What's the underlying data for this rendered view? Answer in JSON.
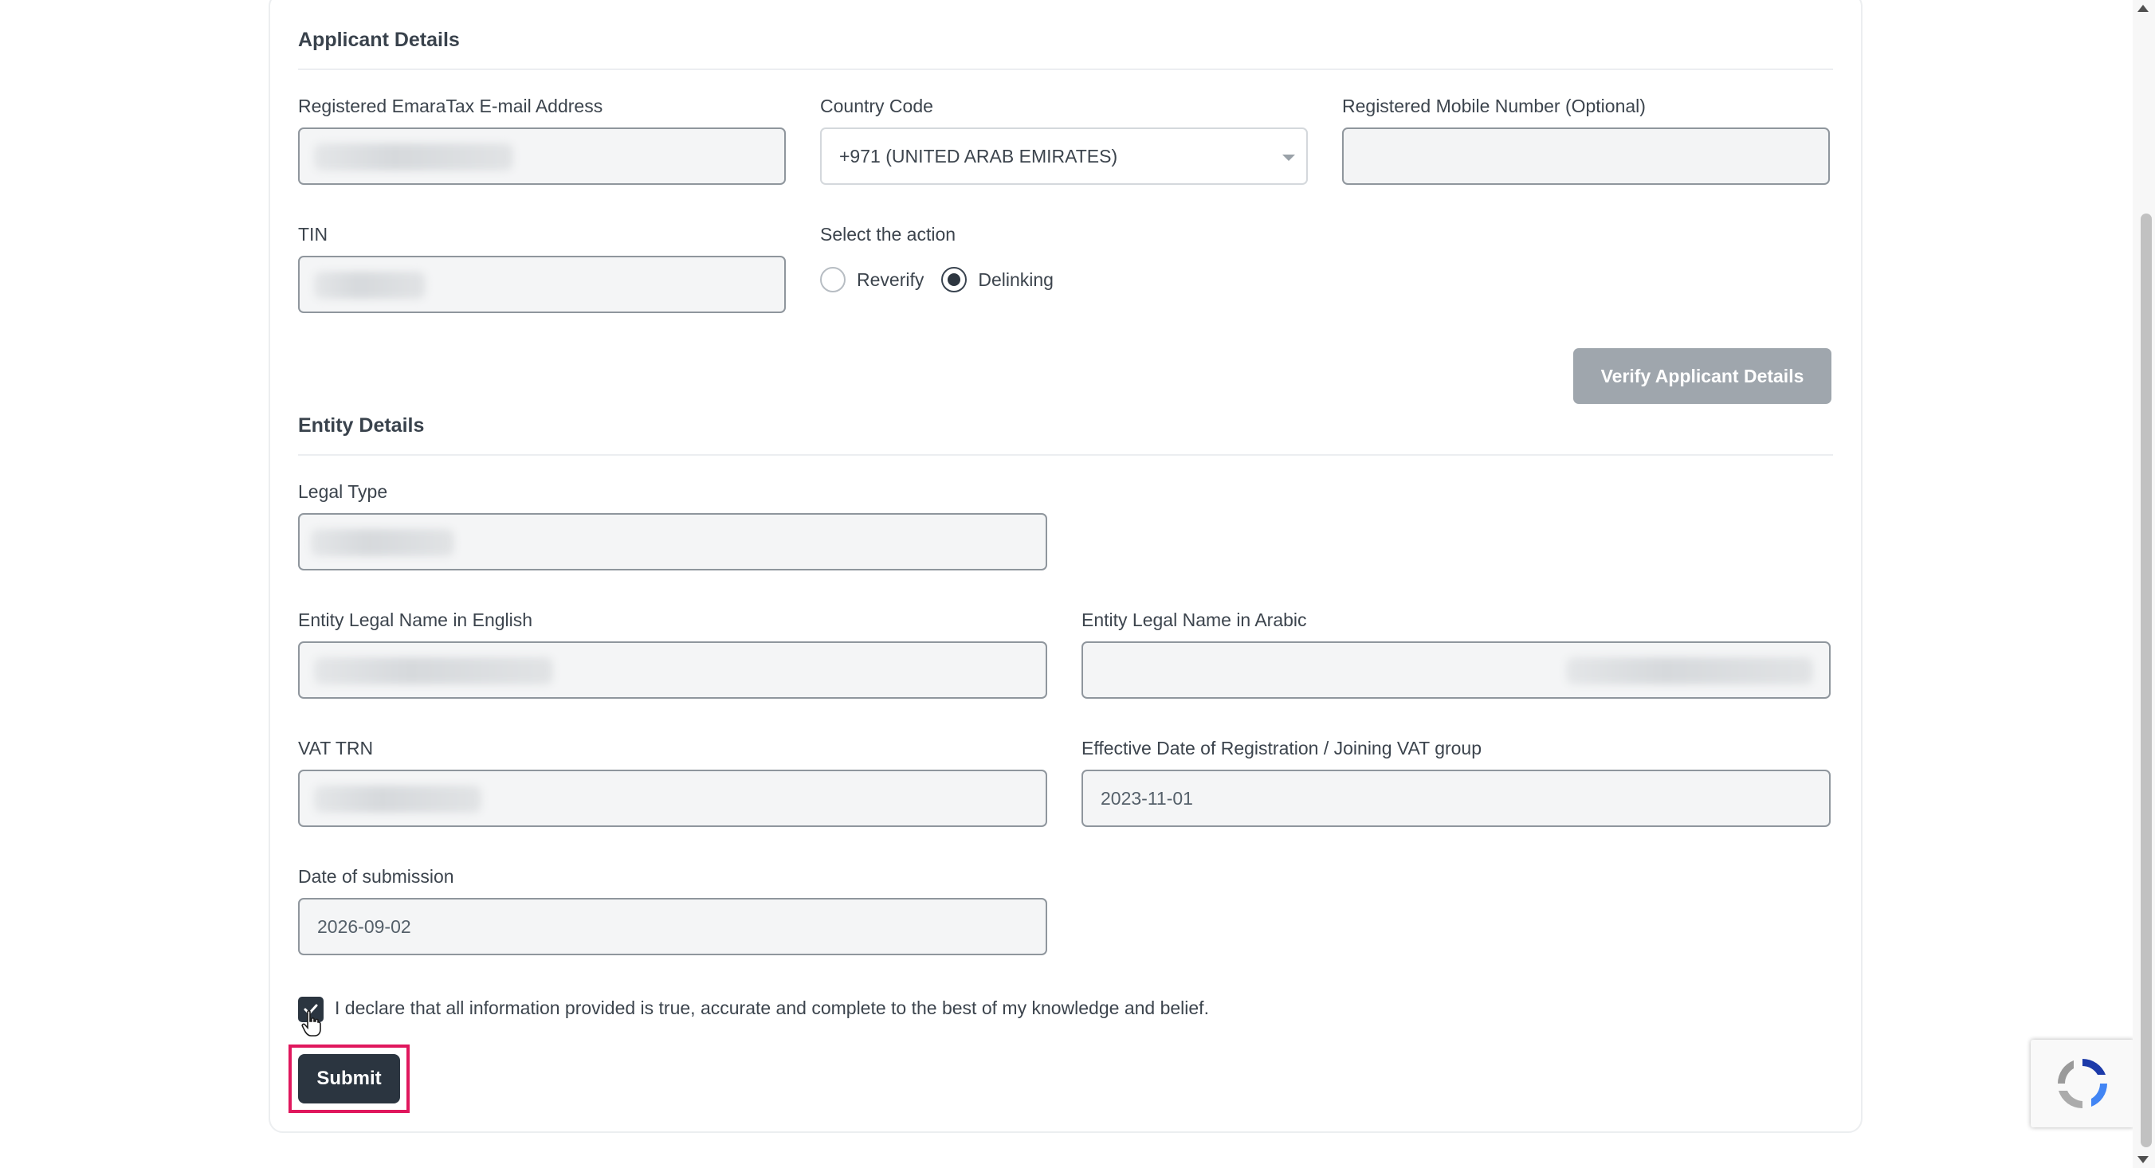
{
  "applicant": {
    "section_title": "Applicant Details",
    "email_label": "Registered EmaraTax E-mail Address",
    "country_label": "Country Code",
    "country_value": "+971 (UNITED ARAB EMIRATES)",
    "mobile_label": "Registered Mobile Number (Optional)",
    "mobile_value": "",
    "tin_label": "TIN",
    "action_label": "Select the action",
    "action_options": [
      "Reverify",
      "Delinking"
    ],
    "action_selected": "Delinking",
    "verify_button": "Verify Applicant Details"
  },
  "entity": {
    "section_title": "Entity Details",
    "legal_type_label": "Legal Type",
    "name_en_label": "Entity Legal Name in English",
    "name_ar_label": "Entity Legal Name in Arabic",
    "vat_trn_label": "VAT TRN",
    "effective_date_label": "Effective Date of Registration / Joining VAT group",
    "effective_date_value": "2023-11-01",
    "submission_date_label": "Date of submission",
    "submission_date_value": "2026-09-02"
  },
  "declaration": {
    "checked": true,
    "text": "I declare that all information provided is true, accurate and complete to the best of my knowledge and belief."
  },
  "submit_button": "Submit",
  "colors": {
    "primary_dark": "#2b3540",
    "disabled_button": "#9fa6ad",
    "highlight": "#e0175d"
  },
  "icons": [
    "check-icon",
    "radio-icon",
    "chevron-down-icon",
    "recaptcha-icon",
    "hand-cursor-icon"
  ]
}
